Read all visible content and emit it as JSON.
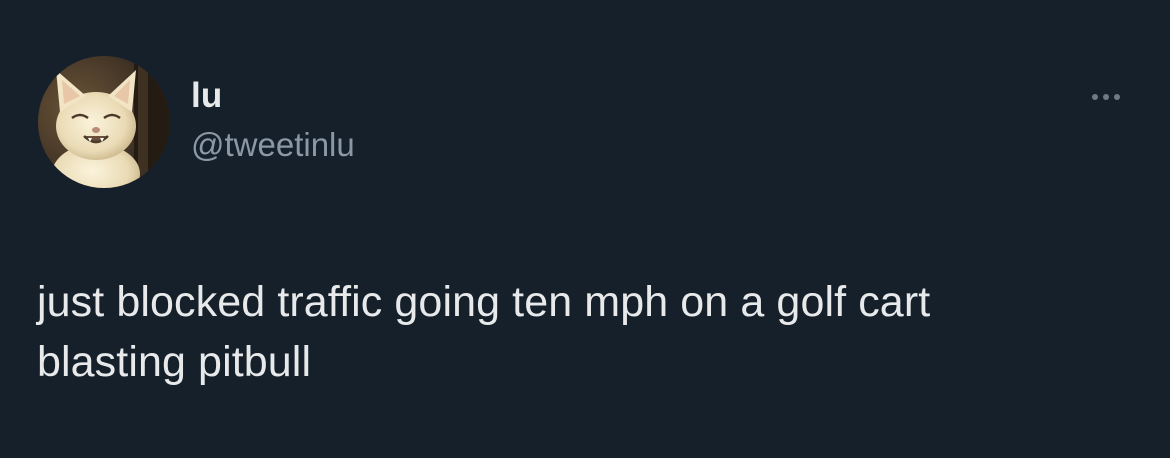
{
  "tweet": {
    "author": {
      "display_name": "lu",
      "handle": "@tweetinlu",
      "avatar_icon": "smiling-cat-avatar"
    },
    "more_icon": "more-options-icon",
    "text": "just blocked traffic going ten mph on a golf cart\nblasting pitbull"
  },
  "colors": {
    "background": "#15202b",
    "primary_text": "#e7e9ea",
    "secondary_text": "#8b98a5"
  }
}
